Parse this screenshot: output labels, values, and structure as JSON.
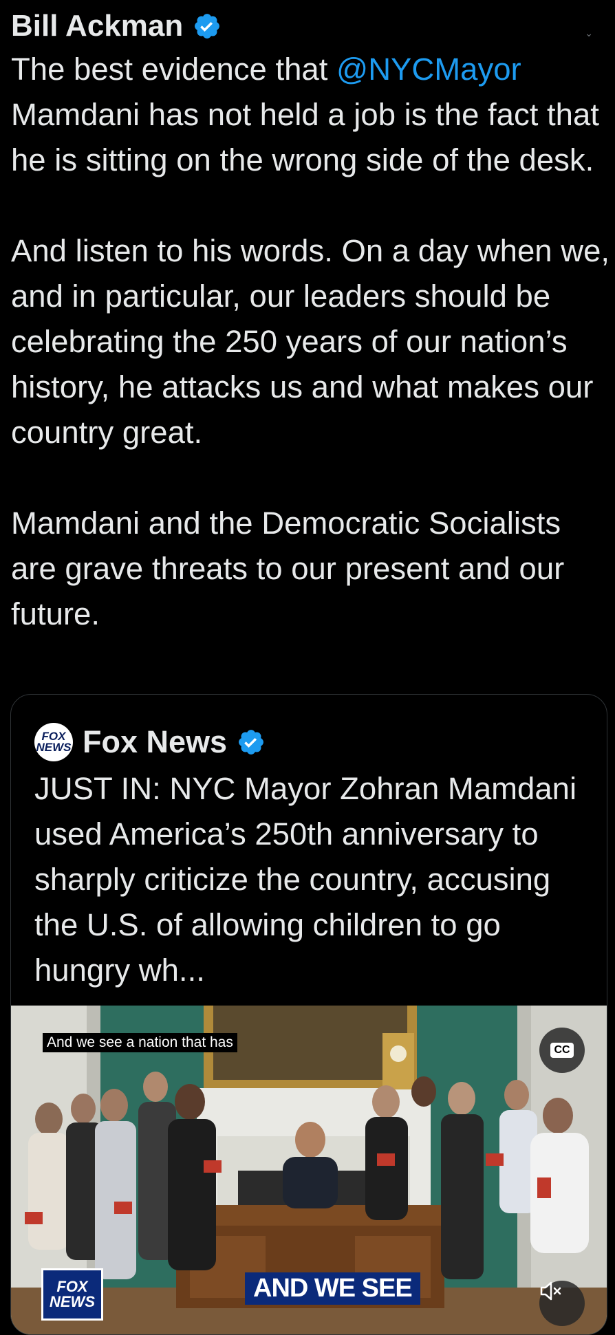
{
  "tweet": {
    "author_name": "Bill Ackman",
    "text_before_mention": "The best evidence that ",
    "mention": "@NYCMayor",
    "text_after_mention": " Mamdani has not held a job is the fact that he is sitting on the wrong side of the desk.\n\nAnd listen to his words. On a day when we, and in particular, our leaders should be celebrating the 250 years of our nation’s history, he attacks us and what makes our country great.\n\nMamdani and the Democratic Socialists are grave threats to our present and our future."
  },
  "quoted_tweet": {
    "author_name": "Fox News",
    "avatar_text": "FOX NEWS",
    "text": "JUST IN: NYC Mayor Zohran Mamdani used America’s 250th anniversary to sharply criticize the country, accusing the U.S. of allowing children to go hungry wh..."
  },
  "video": {
    "caption": "And we see a nation that has",
    "cc_label": "CC",
    "channel_logo_text": "FOX NEWS",
    "lower_third": "AND WE SEE"
  },
  "icons": {
    "verified": "verified-badge-icon",
    "cc": "closed-captions-icon",
    "mute": "volume-muted-icon"
  },
  "colors": {
    "background": "#000000",
    "text": "#e7e9ea",
    "mention": "#1d9bf0",
    "verified": "#1d9bf0"
  }
}
